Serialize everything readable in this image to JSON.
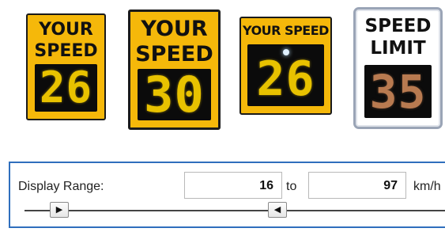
{
  "signs": [
    {
      "line1": "YOUR",
      "line2": "SPEED",
      "value": "26",
      "style": "yellow"
    },
    {
      "line1": "YOUR",
      "line2": "SPEED",
      "value": "30",
      "style": "yellow"
    },
    {
      "line1": "YOUR SPEED",
      "value": "26",
      "style": "yellow-with-radar-dot"
    },
    {
      "line1": "SPEED",
      "line2": "LIMIT",
      "value": "35",
      "style": "white"
    }
  ],
  "range": {
    "label": "Display Range:",
    "min": "16",
    "to_label": "to",
    "max": "97",
    "unit": "km/h",
    "slider_min_icon": "▶",
    "slider_max_icon": "◀"
  },
  "colors": {
    "sign_yellow": "#f5b80a",
    "led_yellow": "#e8c200",
    "led_amber": "#b87a50",
    "panel_border": "#2f6fbd"
  }
}
